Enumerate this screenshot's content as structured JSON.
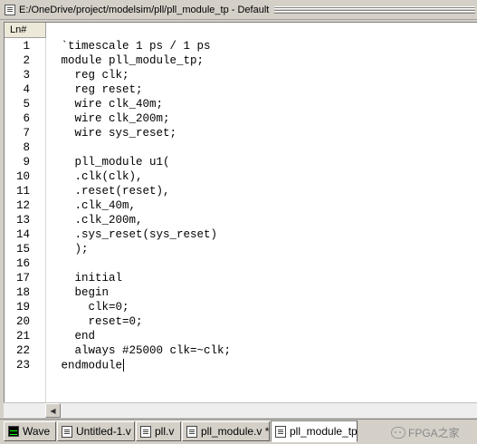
{
  "window": {
    "title": "E:/OneDrive/project/modelsim/pll/pll_module_tp - Default"
  },
  "editor": {
    "gutter_header": "Ln#",
    "lines": [
      {
        "n": "1",
        "text": " `timescale 1 ps / 1 ps"
      },
      {
        "n": "2",
        "text": " module pll_module_tp;"
      },
      {
        "n": "3",
        "text": "   reg clk;"
      },
      {
        "n": "4",
        "text": "   reg reset;"
      },
      {
        "n": "5",
        "text": "   wire clk_40m;"
      },
      {
        "n": "6",
        "text": "   wire clk_200m;"
      },
      {
        "n": "7",
        "text": "   wire sys_reset;"
      },
      {
        "n": "8",
        "text": ""
      },
      {
        "n": "9",
        "text": "   pll_module u1("
      },
      {
        "n": "10",
        "text": "   .clk(clk),"
      },
      {
        "n": "11",
        "text": "   .reset(reset),"
      },
      {
        "n": "12",
        "text": "   .clk_40m,"
      },
      {
        "n": "13",
        "text": "   .clk_200m,"
      },
      {
        "n": "14",
        "text": "   .sys_reset(sys_reset)"
      },
      {
        "n": "15",
        "text": "   );"
      },
      {
        "n": "16",
        "text": ""
      },
      {
        "n": "17",
        "text": "   initial"
      },
      {
        "n": "18",
        "text": "   begin"
      },
      {
        "n": "19",
        "text": "     clk=0;"
      },
      {
        "n": "20",
        "text": "     reset=0;"
      },
      {
        "n": "21",
        "text": "   end"
      },
      {
        "n": "22",
        "text": "   always #25000 clk=~clk;"
      },
      {
        "n": "23",
        "text": " endmodule"
      }
    ]
  },
  "tabs": [
    {
      "label": "Wave",
      "icon": "wave-icon",
      "active": false
    },
    {
      "label": "Untitled-1.v",
      "icon": "file-icon",
      "active": false
    },
    {
      "label": "pll.v",
      "icon": "file-icon",
      "active": false
    },
    {
      "label": "pll_module.v *",
      "icon": "file-icon",
      "active": false
    },
    {
      "label": "pll_module_tp",
      "icon": "file-icon",
      "active": true
    }
  ],
  "watermark": {
    "text": "FPGA之家"
  }
}
